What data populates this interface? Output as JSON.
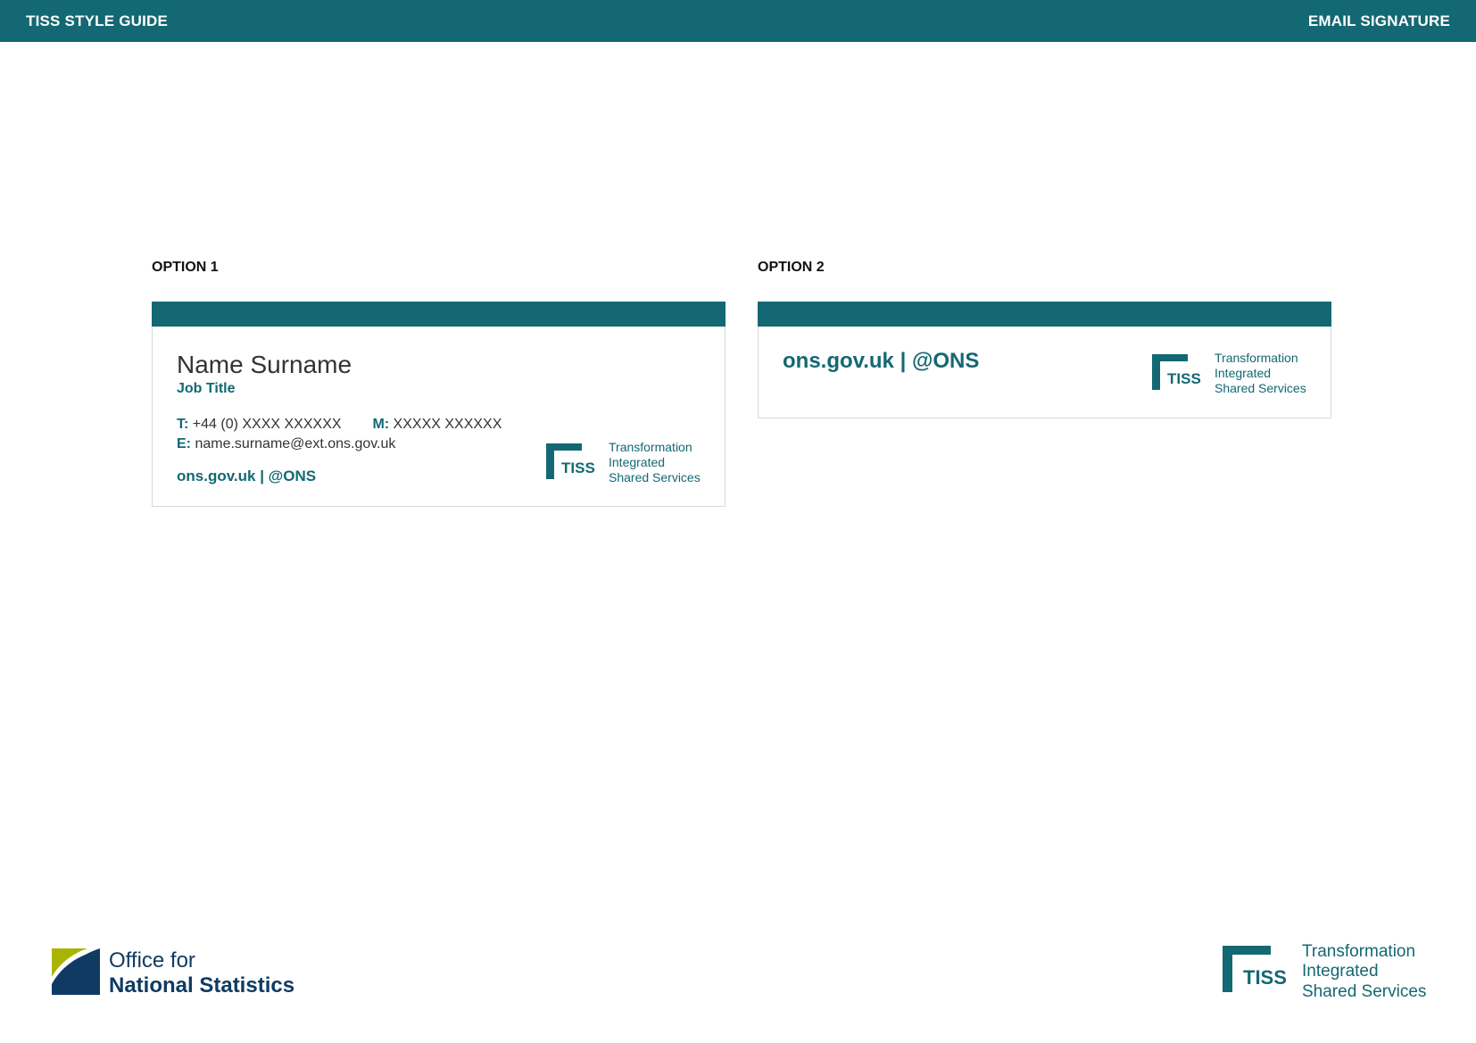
{
  "header": {
    "title": "TISS STYLE GUIDE",
    "section": "EMAIL SIGNATURE"
  },
  "options": [
    {
      "label": "OPTION 1",
      "name": "Name Surname",
      "job_title": "Job Title",
      "phone_label": "T:",
      "phone": "+44 (0) XXXX XXXXXX",
      "mobile_label": "M:",
      "mobile": "XXXXX XXXXXX",
      "email_label": "E:",
      "email": "name.surname@ext.ons.gov.uk",
      "web": "ons.gov.uk | @ONS"
    },
    {
      "label": "OPTION 2",
      "web": "ons.gov.uk | @ONS"
    }
  ],
  "tiss_logo": {
    "mark_text": "TISS",
    "line1": "Transformation",
    "line2": "Integrated",
    "line3": "Shared Services"
  },
  "ons_logo": {
    "line1": "Office for",
    "line2": "National Statistics"
  },
  "colors": {
    "brand_teal": "#136873",
    "ons_navy": "#0f3b63",
    "ons_green": "#a8b400"
  }
}
